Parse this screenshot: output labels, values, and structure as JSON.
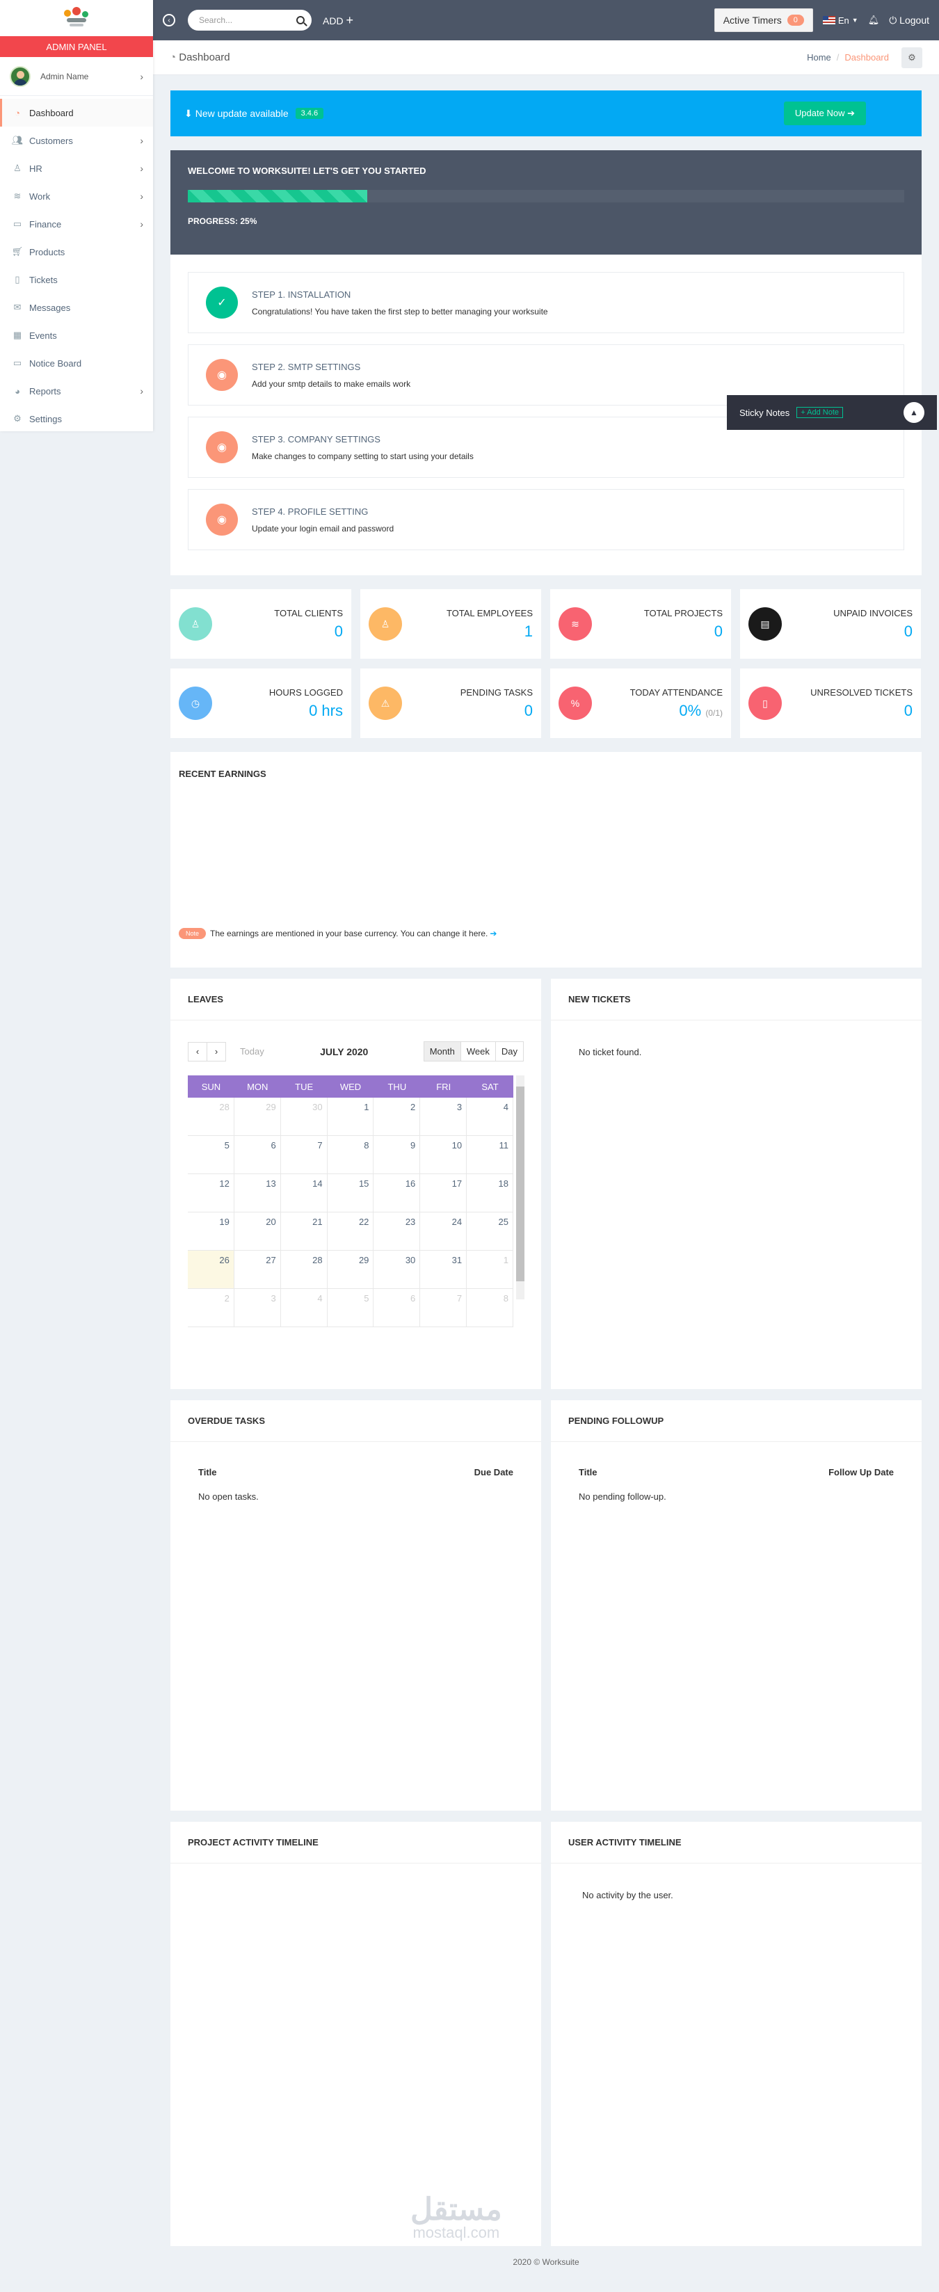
{
  "sidebar": {
    "panel_label": "ADMIN PANEL",
    "user_name": "Admin Name",
    "items": [
      {
        "label": "Dashboard",
        "icon": "dashboard-icon",
        "active": true,
        "has_children": false
      },
      {
        "label": "Customers",
        "icon": "users-icon",
        "has_children": true
      },
      {
        "label": "HR",
        "icon": "user-icon",
        "has_children": true
      },
      {
        "label": "Work",
        "icon": "layers-icon",
        "has_children": true
      },
      {
        "label": "Finance",
        "icon": "money-icon",
        "has_children": true
      },
      {
        "label": "Products",
        "icon": "cart-icon",
        "has_children": false
      },
      {
        "label": "Tickets",
        "icon": "ticket-icon",
        "has_children": false
      },
      {
        "label": "Messages",
        "icon": "envelope-icon",
        "has_children": false
      },
      {
        "label": "Events",
        "icon": "calendar-icon",
        "has_children": false
      },
      {
        "label": "Notice Board",
        "icon": "screen-icon",
        "has_children": false
      },
      {
        "label": "Reports",
        "icon": "pie-chart-icon",
        "has_children": true
      },
      {
        "label": "Settings",
        "icon": "gear-icon",
        "has_children": false
      }
    ]
  },
  "topbar": {
    "search_placeholder": "Search...",
    "add_label": "ADD",
    "active_timers_label": "Active Timers",
    "active_timers_count": "0",
    "language": "En",
    "logout_label": "Logout"
  },
  "breadcrumb": {
    "title": "Dashboard",
    "home": "Home",
    "current": "Dashboard"
  },
  "update": {
    "text": "New update available",
    "version": "3.4.6",
    "button": "Update Now"
  },
  "welcome": {
    "title": "WELCOME TO WORKSUITE! LET'S GET YOU STARTED",
    "progress_label": "PROGRESS: 25%",
    "progress": 25
  },
  "steps": [
    {
      "title": "STEP 1. INSTALLATION",
      "desc": "Congratulations! You have taken the first step to better managing your worksuite",
      "done": true
    },
    {
      "title": "STEP 2. SMTP SETTINGS",
      "desc": "Add your smtp details to make emails work",
      "done": false
    },
    {
      "title": "STEP 3. COMPANY SETTINGS",
      "desc": "Make changes to company setting to start using your details",
      "done": false
    },
    {
      "title": "STEP 4. PROFILE SETTING",
      "desc": "Update your login email and password",
      "done": false
    }
  ],
  "stats": [
    {
      "label": "TOTAL CLIENTS",
      "value": "0",
      "sub": "",
      "color": "#82e0d0",
      "icon": "user-icon"
    },
    {
      "label": "TOTAL EMPLOYEES",
      "value": "1",
      "sub": "",
      "color": "#fdb865",
      "icon": "user-icon"
    },
    {
      "label": "TOTAL PROJECTS",
      "value": "0",
      "sub": "",
      "color": "#f86371",
      "icon": "layers-icon"
    },
    {
      "label": "UNPAID INVOICES",
      "value": "0",
      "sub": "",
      "color": "#1a1a1a",
      "icon": "invoice-icon"
    },
    {
      "label": "HOURS LOGGED",
      "value": "0 hrs",
      "sub": "",
      "color": "#66b6f7",
      "icon": "clock-icon"
    },
    {
      "label": "PENDING TASKS",
      "value": "0",
      "sub": "",
      "color": "#fdb865",
      "icon": "warning-icon"
    },
    {
      "label": "TODAY ATTENDANCE",
      "value": "0%",
      "sub": "(0/1)",
      "color": "#f86371",
      "icon": "percent-icon"
    },
    {
      "label": "UNRESOLVED TICKETS",
      "value": "0",
      "sub": "",
      "color": "#f86371",
      "icon": "ticket-icon"
    }
  ],
  "earnings": {
    "title": "RECENT EARNINGS",
    "note_badge": "Note",
    "note_text": "The earnings are mentioned in your base currency. You can change it here."
  },
  "leaves": {
    "title": "LEAVES",
    "today_label": "Today",
    "month_label": "JULY 2020",
    "views": [
      "Month",
      "Week",
      "Day"
    ],
    "weekdays": [
      "SUN",
      "MON",
      "TUE",
      "WED",
      "THU",
      "FRI",
      "SAT"
    ],
    "days": [
      {
        "d": "28",
        "dim": true
      },
      {
        "d": "29",
        "dim": true
      },
      {
        "d": "30",
        "dim": true
      },
      {
        "d": "1"
      },
      {
        "d": "2"
      },
      {
        "d": "3"
      },
      {
        "d": "4"
      },
      {
        "d": "5"
      },
      {
        "d": "6"
      },
      {
        "d": "7"
      },
      {
        "d": "8"
      },
      {
        "d": "9"
      },
      {
        "d": "10"
      },
      {
        "d": "11"
      },
      {
        "d": "12"
      },
      {
        "d": "13"
      },
      {
        "d": "14"
      },
      {
        "d": "15"
      },
      {
        "d": "16"
      },
      {
        "d": "17"
      },
      {
        "d": "18"
      },
      {
        "d": "19"
      },
      {
        "d": "20"
      },
      {
        "d": "21"
      },
      {
        "d": "22"
      },
      {
        "d": "23"
      },
      {
        "d": "24"
      },
      {
        "d": "25"
      },
      {
        "d": "26",
        "today": true
      },
      {
        "d": "27"
      },
      {
        "d": "28"
      },
      {
        "d": "29"
      },
      {
        "d": "30"
      },
      {
        "d": "31"
      },
      {
        "d": "1",
        "dim": true
      },
      {
        "d": "2",
        "dim": true
      },
      {
        "d": "3",
        "dim": true
      },
      {
        "d": "4",
        "dim": true
      },
      {
        "d": "5",
        "dim": true
      },
      {
        "d": "6",
        "dim": true
      },
      {
        "d": "7",
        "dim": true
      },
      {
        "d": "8",
        "dim": true
      }
    ]
  },
  "tickets": {
    "title": "NEW TICKETS",
    "empty": "No ticket found."
  },
  "overdue": {
    "title": "OVERDUE TASKS",
    "col1": "Title",
    "col2": "Due Date",
    "empty": "No open tasks."
  },
  "followup": {
    "title": "PENDING FOLLOWUP",
    "col1": "Title",
    "col2": "Follow Up Date",
    "empty": "No pending follow-up."
  },
  "project_timeline": {
    "title": "PROJECT ACTIVITY TIMELINE"
  },
  "user_timeline": {
    "title": "USER ACTIVITY TIMELINE",
    "empty": "No activity by the user."
  },
  "sticky": {
    "title": "Sticky Notes",
    "add": "+ Add Note"
  },
  "footer": {
    "text": "2020 © Worksuite"
  },
  "watermark": {
    "text": "مستقل",
    "sub": "mostaql.com"
  }
}
